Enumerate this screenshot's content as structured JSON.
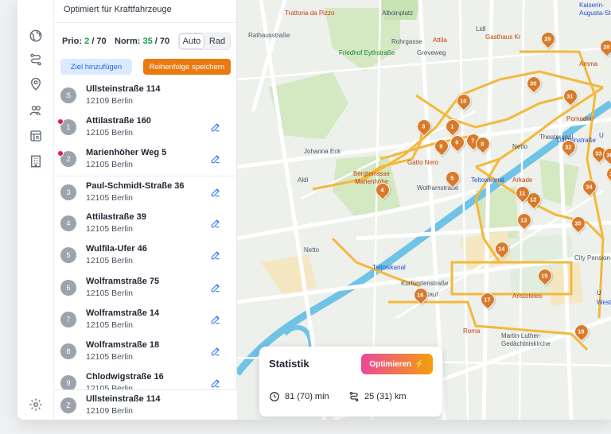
{
  "panel": {
    "optimized_for": "Optimiert für Kraftfahrzeuge",
    "prio_label": "Prio:",
    "prio_value": "2",
    "prio_total": "/ 70",
    "norm_label": "Norm:",
    "norm_value": "35",
    "norm_total": "/ 70",
    "mode_auto": "Auto",
    "mode_rad": "Rad",
    "add_goal": "Ziel hinzufügen",
    "save_order": "Reihenfolge speichern",
    "start": {
      "letter": "S",
      "street": "Ullsteinstraße 114",
      "city": "12109 Berlin"
    },
    "stops": [
      {
        "num": "1",
        "street": "Attilastraße 160",
        "city": "12105 Berlin",
        "priority": true
      },
      {
        "num": "2",
        "street": "Marienhöher Weg 5",
        "city": "12105 Berlin",
        "priority": true
      },
      {
        "num": "3",
        "street": "Paul-Schmidt-Straße 36",
        "city": "12105 Berlin",
        "priority": false
      },
      {
        "num": "4",
        "street": "Attilastraße 39",
        "city": "12105 Berlin",
        "priority": false
      },
      {
        "num": "5",
        "street": "Wulfila-Ufer 46",
        "city": "12105 Berlin",
        "priority": false
      },
      {
        "num": "6",
        "street": "Wolframstraße 75",
        "city": "12105 Berlin",
        "priority": false
      },
      {
        "num": "7",
        "street": "Wolframstraße 14",
        "city": "12105 Berlin",
        "priority": false
      },
      {
        "num": "8",
        "street": "Wolframstraße 18",
        "city": "12105 Berlin",
        "priority": false
      },
      {
        "num": "9",
        "street": "Chlodwigstraße 16",
        "city": "12105 Berlin",
        "priority": false
      }
    ],
    "end": {
      "letter": "Z",
      "street": "Ullsteinstraße 114",
      "city": "12109 Berlin"
    }
  },
  "stats": {
    "title": "Statistik",
    "optimize_label": "Optimieren",
    "time": "81 (70) min",
    "distance": "25 (31) km"
  },
  "map": {
    "labels": [
      "Trattoria da Pizzo",
      "Alboinplatz",
      "Lidl",
      "Attila",
      "Gasthaus Kr",
      "Kaiserin-",
      "Augusta-Straße",
      "Amma",
      "Friedhof Eythstraße",
      "Rathausstraße",
      "Rohrgasse",
      "Greveweg",
      "Pomodori",
      "Theatersaal",
      "Netto",
      "Ullsteinstraße",
      "Johanna Eck",
      "Aldi",
      "Bergterrasse",
      "Marienhöhe",
      "Gatto Nero",
      "Wolframstraße",
      "Teltowkanal",
      "Arkade",
      "Netto",
      "City Pension Sana",
      "Teltowkanal",
      "Kurfürstenstraße",
      "Aristoteles",
      "Westphal",
      "Roma",
      "Martin-Luther-",
      "Gedächtniskirche",
      "hkauf",
      "U",
      "U"
    ],
    "pins": [
      "1",
      "3",
      "4",
      "5",
      "6",
      "7",
      "8",
      "9",
      "10",
      "12",
      "11",
      "13",
      "14",
      "15",
      "16",
      "17",
      "18",
      "28",
      "29",
      "30",
      "31",
      "32",
      "33",
      "34",
      "35",
      "36",
      "37"
    ],
    "road_badge": "96"
  }
}
